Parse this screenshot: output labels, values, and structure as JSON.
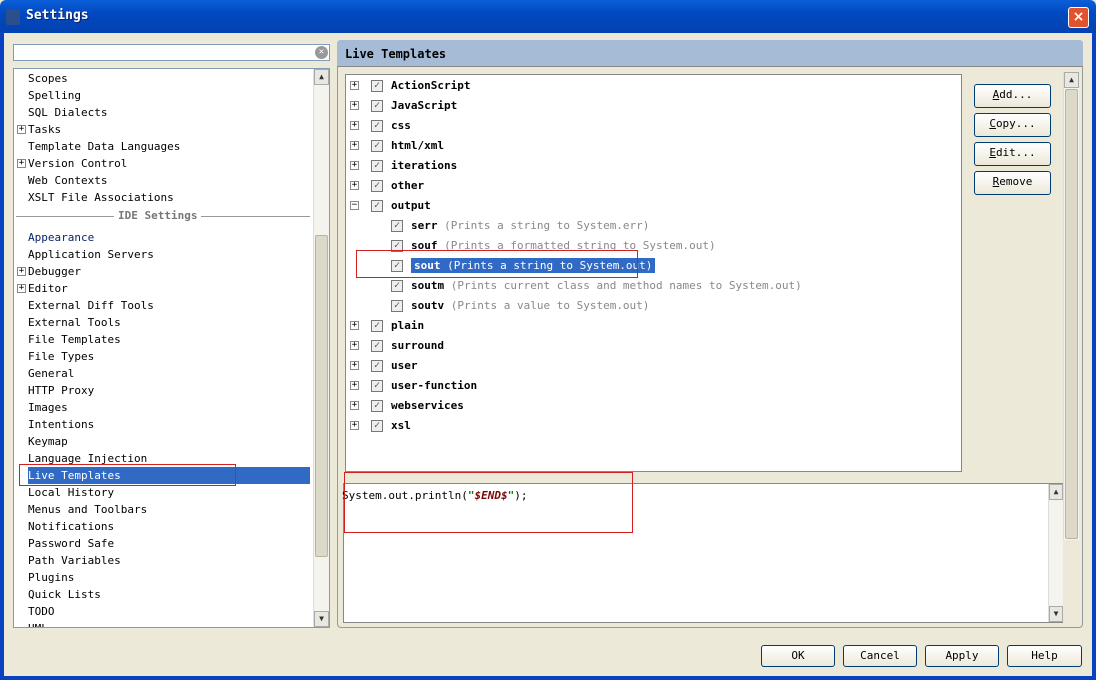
{
  "window": {
    "title": "Settings",
    "close_label": "×"
  },
  "search": {
    "value": "",
    "placeholder": ""
  },
  "left_tree": {
    "project_items": [
      {
        "label": "Scopes",
        "expandable": false
      },
      {
        "label": "Spelling",
        "expandable": false
      },
      {
        "label": "SQL Dialects",
        "expandable": false
      },
      {
        "label": "Tasks",
        "expandable": true
      },
      {
        "label": "Template Data Languages",
        "expandable": false
      },
      {
        "label": "Version Control",
        "expandable": true
      },
      {
        "label": "Web Contexts",
        "expandable": false
      },
      {
        "label": "XSLT File Associations",
        "expandable": false
      }
    ],
    "separator_label": "IDE Settings",
    "ide_items": [
      {
        "label": "Appearance",
        "expandable": false
      },
      {
        "label": "Application Servers",
        "expandable": false
      },
      {
        "label": "Debugger",
        "expandable": true
      },
      {
        "label": "Editor",
        "expandable": true
      },
      {
        "label": "External Diff Tools",
        "expandable": false
      },
      {
        "label": "External Tools",
        "expandable": false
      },
      {
        "label": "File Templates",
        "expandable": false
      },
      {
        "label": "File Types",
        "expandable": false
      },
      {
        "label": "General",
        "expandable": false
      },
      {
        "label": "HTTP Proxy",
        "expandable": false
      },
      {
        "label": "Images",
        "expandable": false
      },
      {
        "label": "Intentions",
        "expandable": false
      },
      {
        "label": "Keymap",
        "expandable": false
      },
      {
        "label": "Language Injection",
        "expandable": false
      },
      {
        "label": "Live Templates",
        "expandable": false,
        "selected": true
      },
      {
        "label": "Local History",
        "expandable": false
      },
      {
        "label": "Menus and Toolbars",
        "expandable": false
      },
      {
        "label": "Notifications",
        "expandable": false
      },
      {
        "label": "Password Safe",
        "expandable": false
      },
      {
        "label": "Path Variables",
        "expandable": false
      },
      {
        "label": "Plugins",
        "expandable": false
      },
      {
        "label": "Quick Lists",
        "expandable": false
      },
      {
        "label": "TODO",
        "expandable": false
      },
      {
        "label": "UML",
        "expandable": false
      }
    ]
  },
  "panel": {
    "title": "Live Templates"
  },
  "templates": {
    "groups_before": [
      "ActionScript",
      "JavaScript",
      "css",
      "html/xml",
      "iterations",
      "other"
    ],
    "expanded_group": "output",
    "children": [
      {
        "abbr": "serr",
        "desc": "(Prints a string to System.err)"
      },
      {
        "abbr": "souf",
        "desc": "(Prints a formatted string to System.out)"
      },
      {
        "abbr": "sout",
        "desc": "(Prints a string to System.out)",
        "selected": true
      },
      {
        "abbr": "soutm",
        "desc": "(Prints current class and method names to System.out)"
      },
      {
        "abbr": "soutv",
        "desc": "(Prints a value to System.out)"
      }
    ],
    "groups_after": [
      "plain",
      "surround",
      "user",
      "user-function",
      "webservices",
      "xsl"
    ]
  },
  "side_buttons": [
    {
      "mn": "A",
      "rest": "dd..."
    },
    {
      "mn": "C",
      "rest": "opy..."
    },
    {
      "mn": "E",
      "rest": "dit..."
    },
    {
      "mn": "R",
      "rest": "emove"
    }
  ],
  "editor": {
    "prefix": "System.out.println(",
    "q1": "\"",
    "var": "$END$",
    "q2": "\"",
    "suffix": ");"
  },
  "footer": {
    "ok": "OK",
    "cancel": "Cancel",
    "apply": "Apply",
    "help": "Help"
  },
  "colors": {
    "selection": "#316ac5",
    "annotation": "#d02020"
  }
}
